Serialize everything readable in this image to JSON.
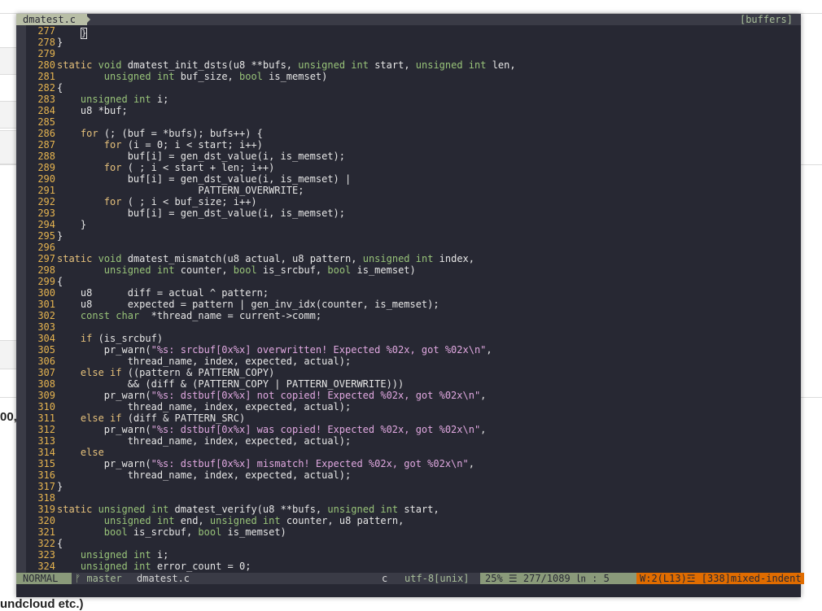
{
  "background": {
    "left_text": "00,",
    "bottom_text": "undcloud etc.)"
  },
  "tabline": {
    "active_tab": "dmatest.c",
    "right_label": "[buffers]"
  },
  "lines": [
    {
      "n": "277",
      "tokens": [
        {
          "t": "    ",
          "c": "src"
        },
        {
          "t": "}",
          "c": "cursor"
        }
      ]
    },
    {
      "n": "278",
      "tokens": [
        {
          "t": "}",
          "c": "src"
        }
      ]
    },
    {
      "n": "279",
      "tokens": []
    },
    {
      "n": "280",
      "tokens": [
        {
          "t": "static",
          "c": "kw"
        },
        {
          "t": " ",
          "c": "src"
        },
        {
          "t": "void",
          "c": "ty"
        },
        {
          "t": " dmatest_init_dsts(u8 **bufs, ",
          "c": "src"
        },
        {
          "t": "unsigned",
          "c": "ty"
        },
        {
          "t": " ",
          "c": "src"
        },
        {
          "t": "int",
          "c": "ty"
        },
        {
          "t": " start, ",
          "c": "src"
        },
        {
          "t": "unsigned",
          "c": "ty"
        },
        {
          "t": " ",
          "c": "src"
        },
        {
          "t": "int",
          "c": "ty"
        },
        {
          "t": " len,",
          "c": "src"
        }
      ]
    },
    {
      "n": "281",
      "tokens": [
        {
          "t": "        ",
          "c": "src"
        },
        {
          "t": "unsigned",
          "c": "ty"
        },
        {
          "t": " ",
          "c": "src"
        },
        {
          "t": "int",
          "c": "ty"
        },
        {
          "t": " buf_size, ",
          "c": "src"
        },
        {
          "t": "bool",
          "c": "ty"
        },
        {
          "t": " is_memset)",
          "c": "src"
        }
      ]
    },
    {
      "n": "282",
      "tokens": [
        {
          "t": "{",
          "c": "src"
        }
      ]
    },
    {
      "n": "283",
      "tokens": [
        {
          "t": "    ",
          "c": "src"
        },
        {
          "t": "unsigned",
          "c": "ty"
        },
        {
          "t": " ",
          "c": "src"
        },
        {
          "t": "int",
          "c": "ty"
        },
        {
          "t": " i;",
          "c": "src"
        }
      ]
    },
    {
      "n": "284",
      "tokens": [
        {
          "t": "    u8 *buf;",
          "c": "src"
        }
      ]
    },
    {
      "n": "285",
      "tokens": []
    },
    {
      "n": "286",
      "tokens": [
        {
          "t": "    ",
          "c": "src"
        },
        {
          "t": "for",
          "c": "kw"
        },
        {
          "t": " (; (buf = *bufs); bufs++) {",
          "c": "src"
        }
      ]
    },
    {
      "n": "287",
      "tokens": [
        {
          "t": "        ",
          "c": "src"
        },
        {
          "t": "for",
          "c": "kw"
        },
        {
          "t": " (i = 0; i < start; i++)",
          "c": "src"
        }
      ]
    },
    {
      "n": "288",
      "tokens": [
        {
          "t": "            buf[i] = gen_dst_value(i, is_memset);",
          "c": "src"
        }
      ]
    },
    {
      "n": "289",
      "tokens": [
        {
          "t": "        ",
          "c": "src"
        },
        {
          "t": "for",
          "c": "kw"
        },
        {
          "t": " ( ; i < start + len; i++)",
          "c": "src"
        }
      ]
    },
    {
      "n": "290",
      "tokens": [
        {
          "t": "            buf[i] = gen_dst_value(i, is_memset) |",
          "c": "src"
        }
      ]
    },
    {
      "n": "291",
      "tokens": [
        {
          "t": "                        PATTERN_OVERWRITE;",
          "c": "src"
        }
      ]
    },
    {
      "n": "292",
      "tokens": [
        {
          "t": "        ",
          "c": "src"
        },
        {
          "t": "for",
          "c": "kw"
        },
        {
          "t": " ( ; i < buf_size; i++)",
          "c": "src"
        }
      ]
    },
    {
      "n": "293",
      "tokens": [
        {
          "t": "            buf[i] = gen_dst_value(i, is_memset);",
          "c": "src"
        }
      ]
    },
    {
      "n": "294",
      "tokens": [
        {
          "t": "    }",
          "c": "src"
        }
      ]
    },
    {
      "n": "295",
      "tokens": [
        {
          "t": "}",
          "c": "src"
        }
      ]
    },
    {
      "n": "296",
      "tokens": []
    },
    {
      "n": "297",
      "tokens": [
        {
          "t": "static",
          "c": "kw"
        },
        {
          "t": " ",
          "c": "src"
        },
        {
          "t": "void",
          "c": "ty"
        },
        {
          "t": " dmatest_mismatch(u8 actual, u8 pattern, ",
          "c": "src"
        },
        {
          "t": "unsigned",
          "c": "ty"
        },
        {
          "t": " ",
          "c": "src"
        },
        {
          "t": "int",
          "c": "ty"
        },
        {
          "t": " index,",
          "c": "src"
        }
      ]
    },
    {
      "n": "298",
      "tokens": [
        {
          "t": "        ",
          "c": "src"
        },
        {
          "t": "unsigned",
          "c": "ty"
        },
        {
          "t": " ",
          "c": "src"
        },
        {
          "t": "int",
          "c": "ty"
        },
        {
          "t": " counter, ",
          "c": "src"
        },
        {
          "t": "bool",
          "c": "ty"
        },
        {
          "t": " is_srcbuf, ",
          "c": "src"
        },
        {
          "t": "bool",
          "c": "ty"
        },
        {
          "t": " is_memset)",
          "c": "src"
        }
      ]
    },
    {
      "n": "299",
      "tokens": [
        {
          "t": "{",
          "c": "src"
        }
      ]
    },
    {
      "n": "300",
      "tokens": [
        {
          "t": "    u8      diff = actual ^ pattern;",
          "c": "src"
        }
      ]
    },
    {
      "n": "301",
      "tokens": [
        {
          "t": "    u8      expected = pattern | gen_inv_idx(counter, is_memset);",
          "c": "src"
        }
      ]
    },
    {
      "n": "302",
      "tokens": [
        {
          "t": "    ",
          "c": "src"
        },
        {
          "t": "const",
          "c": "ty"
        },
        {
          "t": " ",
          "c": "src"
        },
        {
          "t": "char",
          "c": "ty"
        },
        {
          "t": "  *thread_name = current->comm;",
          "c": "src"
        }
      ]
    },
    {
      "n": "303",
      "tokens": []
    },
    {
      "n": "304",
      "tokens": [
        {
          "t": "    ",
          "c": "src"
        },
        {
          "t": "if",
          "c": "kw"
        },
        {
          "t": " (is_srcbuf)",
          "c": "src"
        }
      ]
    },
    {
      "n": "305",
      "tokens": [
        {
          "t": "        pr_warn(",
          "c": "src"
        },
        {
          "t": "\"%s: srcbuf[0x%x] overwritten! Expected %02x, got %02x\\n\"",
          "c": "st"
        },
        {
          "t": ",",
          "c": "src"
        }
      ]
    },
    {
      "n": "306",
      "tokens": [
        {
          "t": "            thread_name, index, expected, actual);",
          "c": "src"
        }
      ]
    },
    {
      "n": "307",
      "tokens": [
        {
          "t": "    ",
          "c": "src"
        },
        {
          "t": "else",
          "c": "kw"
        },
        {
          "t": " ",
          "c": "src"
        },
        {
          "t": "if",
          "c": "kw"
        },
        {
          "t": " ((pattern & PATTERN_COPY)",
          "c": "src"
        }
      ]
    },
    {
      "n": "308",
      "tokens": [
        {
          "t": "            && (diff & (PATTERN_COPY | PATTERN_OVERWRITE)))",
          "c": "src"
        }
      ]
    },
    {
      "n": "309",
      "tokens": [
        {
          "t": "        pr_warn(",
          "c": "src"
        },
        {
          "t": "\"%s: dstbuf[0x%x] not copied! Expected %02x, got %02x\\n\"",
          "c": "st"
        },
        {
          "t": ",",
          "c": "src"
        }
      ]
    },
    {
      "n": "310",
      "tokens": [
        {
          "t": "            thread_name, index, expected, actual);",
          "c": "src"
        }
      ]
    },
    {
      "n": "311",
      "tokens": [
        {
          "t": "    ",
          "c": "src"
        },
        {
          "t": "else",
          "c": "kw"
        },
        {
          "t": " ",
          "c": "src"
        },
        {
          "t": "if",
          "c": "kw"
        },
        {
          "t": " (diff & PATTERN_SRC)",
          "c": "src"
        }
      ]
    },
    {
      "n": "312",
      "tokens": [
        {
          "t": "        pr_warn(",
          "c": "src"
        },
        {
          "t": "\"%s: dstbuf[0x%x] was copied! Expected %02x, got %02x\\n\"",
          "c": "st"
        },
        {
          "t": ",",
          "c": "src"
        }
      ]
    },
    {
      "n": "313",
      "tokens": [
        {
          "t": "            thread_name, index, expected, actual);",
          "c": "src"
        }
      ]
    },
    {
      "n": "314",
      "tokens": [
        {
          "t": "    ",
          "c": "src"
        },
        {
          "t": "else",
          "c": "kw"
        }
      ]
    },
    {
      "n": "315",
      "tokens": [
        {
          "t": "        pr_warn(",
          "c": "src"
        },
        {
          "t": "\"%s: dstbuf[0x%x] mismatch! Expected %02x, got %02x\\n\"",
          "c": "st"
        },
        {
          "t": ",",
          "c": "src"
        }
      ]
    },
    {
      "n": "316",
      "tokens": [
        {
          "t": "            thread_name, index, expected, actual);",
          "c": "src"
        }
      ]
    },
    {
      "n": "317",
      "tokens": [
        {
          "t": "}",
          "c": "src"
        }
      ]
    },
    {
      "n": "318",
      "tokens": []
    },
    {
      "n": "319",
      "tokens": [
        {
          "t": "static",
          "c": "kw"
        },
        {
          "t": " ",
          "c": "src"
        },
        {
          "t": "unsigned",
          "c": "ty"
        },
        {
          "t": " ",
          "c": "src"
        },
        {
          "t": "int",
          "c": "ty"
        },
        {
          "t": " dmatest_verify(u8 **bufs, ",
          "c": "src"
        },
        {
          "t": "unsigned",
          "c": "ty"
        },
        {
          "t": " ",
          "c": "src"
        },
        {
          "t": "int",
          "c": "ty"
        },
        {
          "t": " start,",
          "c": "src"
        }
      ]
    },
    {
      "n": "320",
      "tokens": [
        {
          "t": "        ",
          "c": "src"
        },
        {
          "t": "unsigned",
          "c": "ty"
        },
        {
          "t": " ",
          "c": "src"
        },
        {
          "t": "int",
          "c": "ty"
        },
        {
          "t": " end, ",
          "c": "src"
        },
        {
          "t": "unsigned",
          "c": "ty"
        },
        {
          "t": " ",
          "c": "src"
        },
        {
          "t": "int",
          "c": "ty"
        },
        {
          "t": " counter, u8 pattern,",
          "c": "src"
        }
      ]
    },
    {
      "n": "321",
      "tokens": [
        {
          "t": "        ",
          "c": "src"
        },
        {
          "t": "bool",
          "c": "ty"
        },
        {
          "t": " is_srcbuf, ",
          "c": "src"
        },
        {
          "t": "bool",
          "c": "ty"
        },
        {
          "t": " is_memset)",
          "c": "src"
        }
      ]
    },
    {
      "n": "322",
      "tokens": [
        {
          "t": "{",
          "c": "src"
        }
      ]
    },
    {
      "n": "323",
      "tokens": [
        {
          "t": "    ",
          "c": "src"
        },
        {
          "t": "unsigned",
          "c": "ty"
        },
        {
          "t": " ",
          "c": "src"
        },
        {
          "t": "int",
          "c": "ty"
        },
        {
          "t": " i;",
          "c": "src"
        }
      ]
    },
    {
      "n": "324",
      "tokens": [
        {
          "t": "    ",
          "c": "src"
        },
        {
          "t": "unsigned",
          "c": "ty"
        },
        {
          "t": " ",
          "c": "src"
        },
        {
          "t": "int",
          "c": "ty"
        },
        {
          "t": " error_count = 0;",
          "c": "src"
        }
      ]
    }
  ],
  "statusline": {
    "mode": "NORMAL",
    "branch": "ᚠ master",
    "filename": "dmatest.c",
    "filetype": "c",
    "encoding": "utf-8[unix]",
    "position": "25% ☰  277/1089 ㏑ :  5",
    "warning": "W:2(L13)☲ [338]mixed-indent"
  },
  "colors": {
    "background": "#272833",
    "line_number": "#e6b450",
    "keyword": "#e5c07b",
    "type": "#98c379",
    "string": "#e0a8e0",
    "mode_bg": "#8a9a7a",
    "warning_bg": "#e06c00"
  }
}
